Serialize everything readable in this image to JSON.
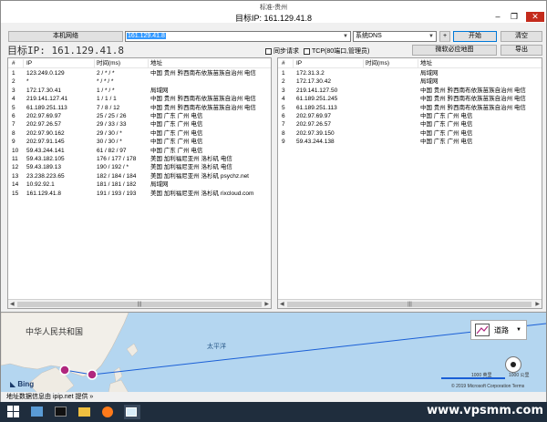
{
  "titlebar": {
    "app_title": "标准-贵州",
    "window_title": "目标IP: 161.129.41.8"
  },
  "toolbar": {
    "local_network_button": "本机网络",
    "target_input_value": "161.129.41.8",
    "dns_select_value": "系统DNS",
    "plus_button": "+",
    "start_button": "开始",
    "clear_button": "清空",
    "stats_button": "微软必应地图",
    "export_button": "导出"
  },
  "target_display": "目标IP:  161.129.41.8",
  "options": {
    "sync_request": "同步请求",
    "tcp_option": "TCP(80端口,管理员)"
  },
  "left_table": {
    "headers": [
      "#",
      "IP",
      "时间(ms)",
      "地址"
    ],
    "rows": [
      [
        "1",
        "123.249.0.129",
        "2 / * / *",
        "中国 贵州 黔西南布依族苗族自治州 电信"
      ],
      [
        "2",
        "*",
        "* / * / *",
        ""
      ],
      [
        "3",
        "172.17.30.41",
        "1 / * / *",
        "局域网"
      ],
      [
        "4",
        "219.141.127.41",
        "1 / 1 / 1",
        "中国 贵州 黔西南布依族苗族自治州 电信"
      ],
      [
        "5",
        "61.189.251.113",
        "7 / 8 / 12",
        "中国 贵州 黔西南布依族苗族自治州 电信"
      ],
      [
        "6",
        "202.97.69.97",
        "25 / 25 / 26",
        "中国 广东 广州 电信"
      ],
      [
        "7",
        "202.97.26.57",
        "29 / 33 / 33",
        "中国 广东 广州 电信"
      ],
      [
        "8",
        "202.97.90.162",
        "29 / 30 / *",
        "中国 广东 广州 电信"
      ],
      [
        "9",
        "202.97.91.145",
        "30 / 30 / *",
        "中国 广东 广州 电信"
      ],
      [
        "10",
        "59.43.244.141",
        "61 / 82 / 97",
        "中国 广东 广州 电信"
      ],
      [
        "11",
        "59.43.182.105",
        "176 / 177 / 178",
        "美国 加利福尼亚州 洛杉矶 电信"
      ],
      [
        "12",
        "59.43.189.13",
        "190 / 192 / *",
        "美国 加利福尼亚州 洛杉矶 电信"
      ],
      [
        "13",
        "23.238.223.65",
        "182 / 184 / 184",
        "美国 加利福尼亚州 洛杉矶 psychz.net"
      ],
      [
        "14",
        "10.92.92.1",
        "181 / 181 / 182",
        "局域网"
      ],
      [
        "15",
        "161.129.41.8",
        "191 / 193 / 193",
        "美国 加利福尼亚州 洛杉矶 rixcloud.com"
      ]
    ]
  },
  "right_table": {
    "headers": [
      "#",
      "IP",
      "时间(ms)",
      "地址"
    ],
    "rows": [
      [
        "1",
        "172.31.3.2",
        "",
        "局域网"
      ],
      [
        "2",
        "172.17.30.42",
        "",
        "局域网"
      ],
      [
        "3",
        "219.141.127.50",
        "",
        "中国 贵州 黔西南布依族苗族自治州 电信"
      ],
      [
        "4",
        "61.189.251.245",
        "",
        "中国 贵州 黔西南布依族苗族自治州 电信"
      ],
      [
        "5",
        "61.189.251.113",
        "",
        "中国 贵州 黔西南布依族苗族自治州 电信"
      ],
      [
        "6",
        "202.97.69.97",
        "",
        "中国 广东 广州 电信"
      ],
      [
        "7",
        "202.97.26.57",
        "",
        "中国 广东 广州 电信"
      ],
      [
        "8",
        "202.97.39.150",
        "",
        "中国 广东 广州 电信"
      ],
      [
        "9",
        "59.43.244.138",
        "",
        "中国 广东 广州 电信"
      ]
    ]
  },
  "map": {
    "china_label": "中华人民共和国",
    "ocean_label": "太平洋",
    "road_button": "道路",
    "bing_label": "Bing",
    "scale_label": "1000 英里",
    "scale_label_km": "1000 公里",
    "copyright": "© 2019 Microsoft Corporation  Terms"
  },
  "status_bar": "地址数据信息由 ipip.net 提供 »",
  "watermark": "www.vpsmm.com",
  "colors": {
    "map_sea": "#b4d6f0",
    "map_land": "#f2efe9",
    "route_line": "#1a5fd6",
    "marker": "#b0277e",
    "selected": "#3399ff"
  }
}
